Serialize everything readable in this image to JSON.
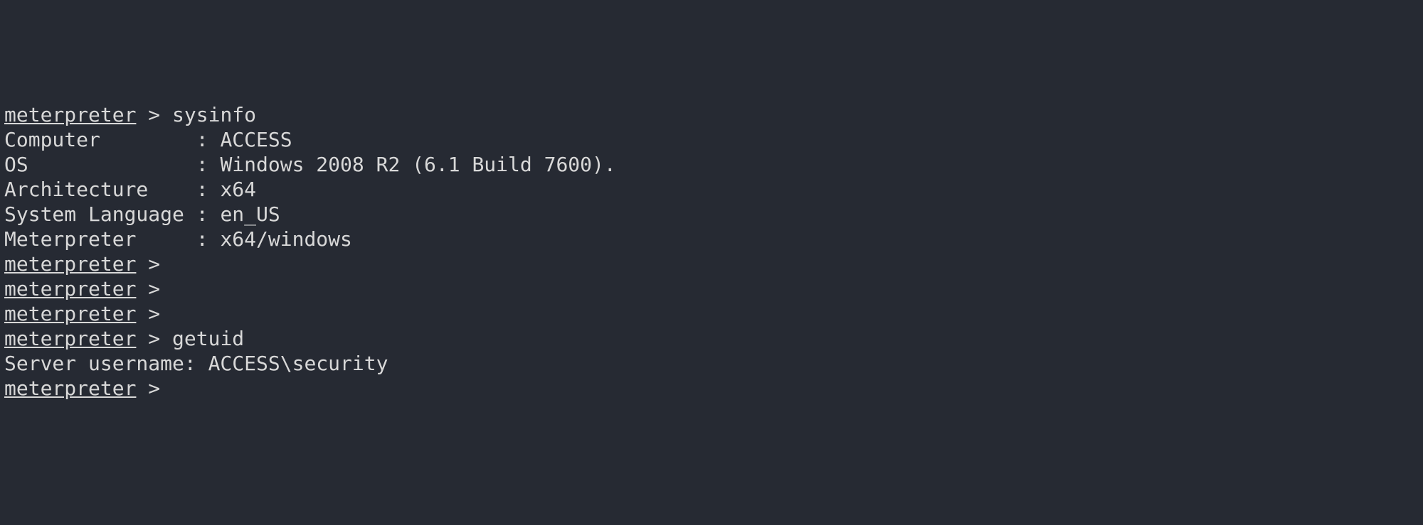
{
  "prompt": "meterpreter",
  "gt": " > ",
  "commands": {
    "sysinfo": "sysinfo",
    "getuid": "getuid"
  },
  "sysinfo": {
    "computer_label": "Computer        : ",
    "computer_value": "ACCESS",
    "os_label": "OS              : ",
    "os_value": "Windows 2008 R2 (6.1 Build 7600).",
    "arch_label": "Architecture    : ",
    "arch_value": "x64",
    "lang_label": "System Language : ",
    "lang_value": "en_US",
    "met_label": "Meterpreter     : ",
    "met_value": "x64/windows"
  },
  "getuid": {
    "label": "Server username: ",
    "value": "ACCESS\\security"
  }
}
